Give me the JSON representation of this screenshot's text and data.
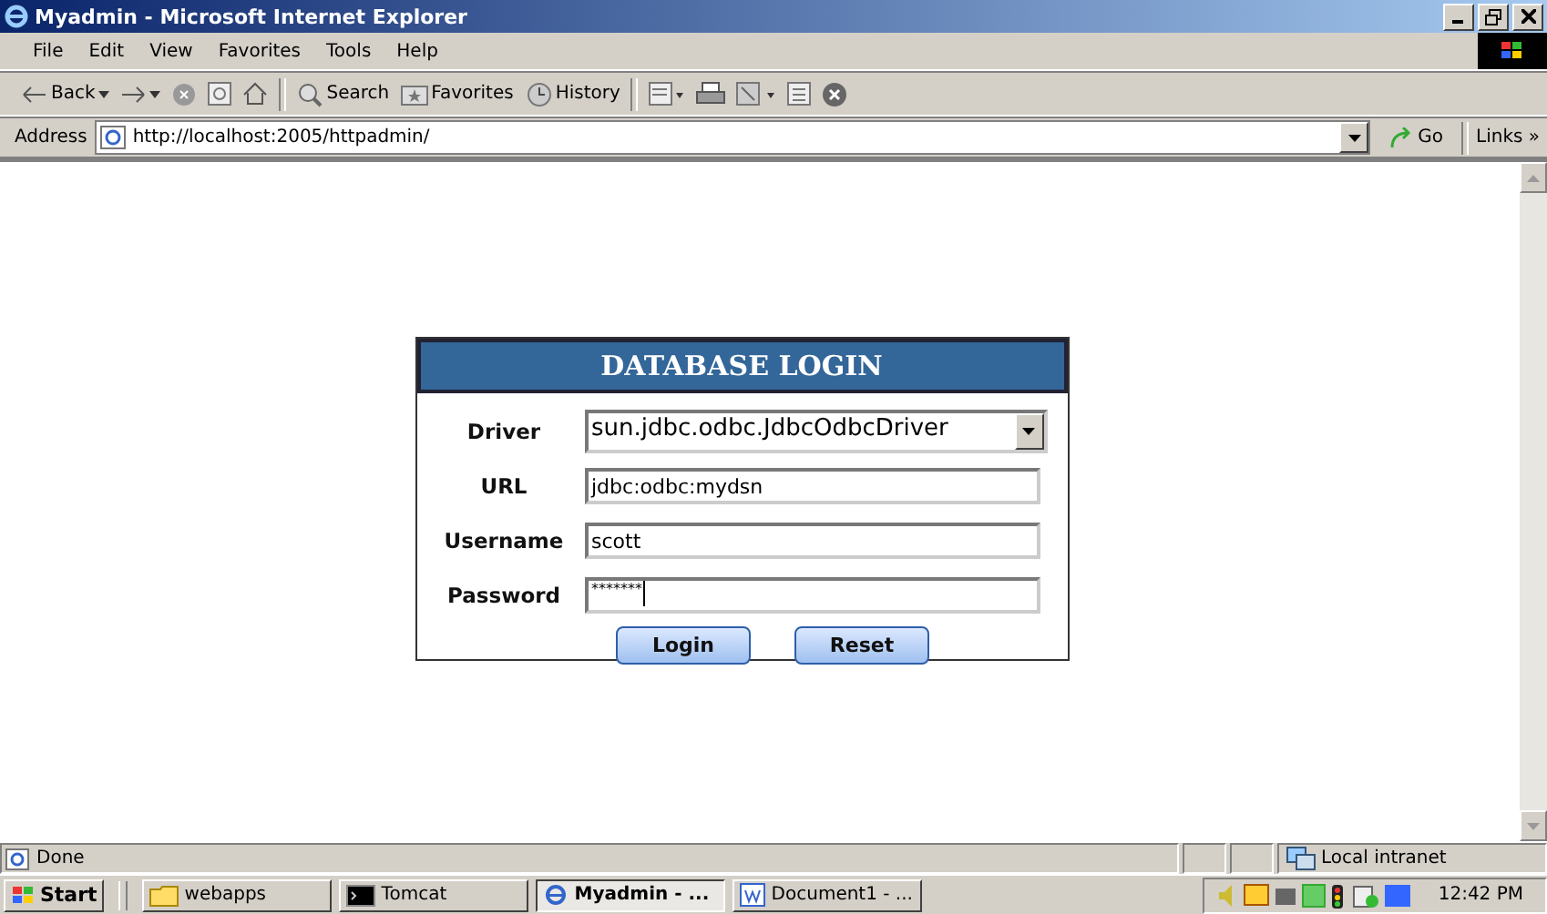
{
  "window": {
    "title": "Myadmin - Microsoft Internet Explorer"
  },
  "menu": [
    "File",
    "Edit",
    "View",
    "Favorites",
    "Tools",
    "Help"
  ],
  "toolbar": [
    {
      "kind": "back",
      "label": "Back"
    },
    {
      "kind": "forward"
    },
    {
      "kind": "stop"
    },
    {
      "kind": "refresh"
    },
    {
      "kind": "home"
    },
    {
      "kind": "search",
      "label": "Search"
    },
    {
      "kind": "favorites",
      "label": "Favorites"
    },
    {
      "kind": "history",
      "label": "History"
    },
    {
      "kind": "mail"
    },
    {
      "kind": "print"
    },
    {
      "kind": "edit"
    },
    {
      "kind": "discuss"
    },
    {
      "kind": "messenger"
    }
  ],
  "address": {
    "label": "Address",
    "url": "http://localhost:2005/httpadmin/",
    "go": "Go",
    "links": "Links »"
  },
  "login": {
    "title": "DATABASE LOGIN",
    "fields": [
      {
        "kind": "select",
        "label": "Driver",
        "value": "sun.jdbc.odbc.JdbcOdbcDriver"
      },
      {
        "kind": "text",
        "label": "URL",
        "value": "jdbc:odbc:mydsn"
      },
      {
        "kind": "text",
        "label": "Username",
        "value": "scott"
      },
      {
        "kind": "password",
        "label": "Password",
        "value": "*******"
      }
    ],
    "buttons": [
      "Login",
      "Reset"
    ]
  },
  "status_bar": {
    "text": "Done",
    "zone": "Local intranet"
  },
  "taskbar": {
    "start": "Start",
    "tasks": [
      {
        "label": "webapps",
        "kind": "folder",
        "selected": false
      },
      {
        "label": "Tomcat",
        "kind": "console",
        "selected": false
      },
      {
        "label": "Myadmin - ...",
        "kind": "ie",
        "selected": true
      },
      {
        "label": "Document1 - ...",
        "kind": "word",
        "selected": false
      }
    ],
    "clock": "12:42 PM"
  }
}
